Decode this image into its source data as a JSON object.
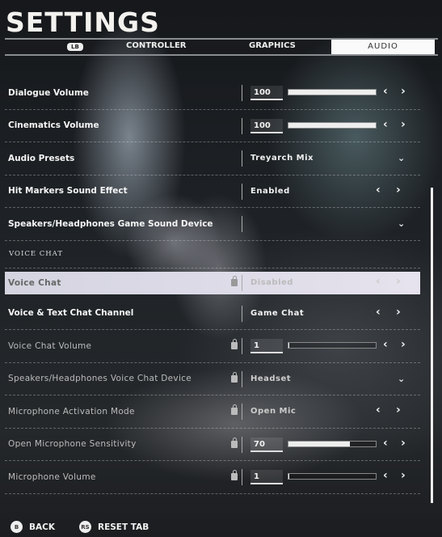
{
  "header": {
    "title": "SETTINGS"
  },
  "tabs": {
    "lb": "LB",
    "items": [
      {
        "label": "CONTROLLER"
      },
      {
        "label": "GRAPHICS"
      },
      {
        "label": "AUDIO",
        "active": true
      }
    ]
  },
  "rows_top": [
    {
      "label": "Dialogue Volume",
      "type": "slider",
      "value": "100",
      "percent": 100
    },
    {
      "label": "Cinematics Volume",
      "type": "slider",
      "value": "100",
      "percent": 100
    },
    {
      "label": "Audio Presets",
      "type": "dropdown",
      "value": "Treyarch Mix"
    },
    {
      "label": "Hit Markers Sound Effect",
      "type": "selector",
      "value": "Enabled"
    },
    {
      "label": "Speakers/Headphones Game Sound Device",
      "type": "dropdown",
      "value": ""
    }
  ],
  "section_voice": "VOICE CHAT",
  "rows_voice": [
    {
      "label": "Voice Chat",
      "type": "selector",
      "value": "Disabled",
      "locked": true,
      "highlighted": true
    },
    {
      "label": "Voice & Text Chat Channel",
      "type": "selector",
      "value": "Game Chat"
    },
    {
      "label": "Voice Chat Volume",
      "type": "slider",
      "value": "1",
      "percent": 1,
      "locked": true
    },
    {
      "label": "Speakers/Headphones Voice Chat Device",
      "type": "dropdown",
      "value": "Headset",
      "locked": true
    },
    {
      "label": "Microphone Activation Mode",
      "type": "selector",
      "value": "Open Mic",
      "locked": true
    },
    {
      "label": "Open Microphone Sensitivity",
      "type": "slider",
      "value": "70",
      "percent": 70,
      "locked": true
    },
    {
      "label": "Microphone Volume",
      "type": "slider",
      "value": "1",
      "percent": 1,
      "locked": true
    }
  ],
  "footer": {
    "back_icon": "B",
    "back": "BACK",
    "reset_icon": "RS",
    "reset": "RESET TAB"
  },
  "icons": {
    "left": "‹",
    "right": "›",
    "down": "⌄"
  }
}
